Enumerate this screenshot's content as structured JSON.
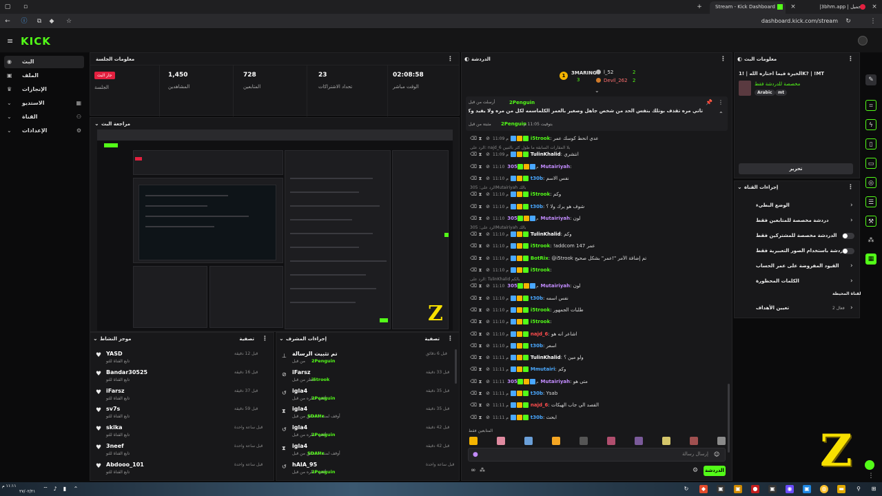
{
  "browser": {
    "tab_active": "Stream - Kick Dashboard",
    "tab_other": "|3bhm.app | تحميل",
    "url": "dashboard.kick.com/stream"
  },
  "kick": {
    "logo": "KICK"
  },
  "sidebar": {
    "items": [
      {
        "label": "البث",
        "icon": "broadcast-icon"
      },
      {
        "label": "الملف",
        "icon": "profile-icon"
      },
      {
        "label": "الإنجازات",
        "icon": "trophy-icon"
      },
      {
        "label": "الاستديو",
        "icon": "studio-icon"
      },
      {
        "label": "القناة",
        "icon": "channel-icon"
      },
      {
        "label": "الإعدادات",
        "icon": "settings-icon"
      }
    ]
  },
  "session": {
    "title": "معلومات الجلسة",
    "live_badge": "جار البث",
    "live_label": "الجلسة",
    "stats": [
      {
        "value": "1,450",
        "label": "المشاهدين"
      },
      {
        "value": "728",
        "label": "المتابعين"
      },
      {
        "value": "23",
        "label": "تحداد الاشتراكات"
      },
      {
        "value": "02:08:58",
        "label": "الوقت مباشر"
      }
    ]
  },
  "preview": {
    "title": "مراجعة البث"
  },
  "activity": {
    "title": "موجز النشاط",
    "filter": "تصفية",
    "items": [
      {
        "name": "YASD",
        "sub": "تابع القناة للتو",
        "time": "قبل 12 دقيقة"
      },
      {
        "name": "Bandar30525",
        "sub": "تابع القناة للتو",
        "time": "قبل 16 دقيقة"
      },
      {
        "name": "iFarsz",
        "sub": "تابع القناة للتو",
        "time": "قبل 37 دقيقة"
      },
      {
        "name": "sv7s",
        "sub": "تابع القناة للتو",
        "time": "قبل 59 دقيقة"
      },
      {
        "name": "skika",
        "sub": "تابع القناة للتو",
        "time": "قبل ساعة واحدة"
      },
      {
        "name": "3neef",
        "sub": "تابع القناة للتو",
        "time": "قبل ساعة واحدة"
      },
      {
        "name": "Abdooo_101",
        "sub": "تابع القناة للتو",
        "time": "قبل ساعة واحدة"
      }
    ]
  },
  "modactions": {
    "title": "إجراءات المشرف",
    "filter": "تصفية",
    "items": [
      {
        "name": "تم تثبيت الرسالة",
        "sub": "من قبل",
        "by": "2Penguin",
        "time": "قبل 6 دقائق",
        "icon": "pin-icon"
      },
      {
        "name": "iFarsz",
        "sub": "حظر من قبل",
        "by": "i5trook",
        "time": "قبل 33 دقيقة",
        "icon": "ban-icon"
      },
      {
        "name": "igla4",
        "sub": "ألغي حظره من قبل",
        "by": "2Penguin",
        "time": "قبل 35 دقيقة",
        "icon": "undo-icon"
      },
      {
        "name": "igla4",
        "sub": "أوقف لمدة 5 دقائق من قبل",
        "by": "SDAHx",
        "time": "قبل 35 دقيقة",
        "icon": "hourglass-icon"
      },
      {
        "name": "igla4",
        "sub": "ألغي حظره من قبل",
        "by": "2Penguin",
        "time": "قبل 42 دقيقة",
        "icon": "undo-icon"
      },
      {
        "name": "igla4",
        "sub": "أوقف لمدة 5 دقائق من قبل",
        "by": "SDAHx",
        "time": "قبل 42 دقيقة",
        "icon": "hourglass-icon"
      },
      {
        "name": "hAIA_95",
        "sub": "ألغي حظره من قبل",
        "by": "2Penguin",
        "time": "قبل ساعة واحدة",
        "icon": "undo-icon"
      }
    ]
  },
  "chat": {
    "title": "الدردشة",
    "top": [
      {
        "name": "3MARING",
        "count": "3"
      },
      {
        "name": "l_52",
        "count": "2"
      },
      {
        "name": "Devil_262",
        "count": "2"
      }
    ],
    "pinned": {
      "header": "أرسلت من قبل",
      "by": "2Penguin",
      "text": "تاتي مره تقذف بوتلك بنفس الحد من شخص جاهل وصغير بالعمر الكلماسمه لكل من مره ولا يفيد وكثرو الادعاء عليه",
      "footer_time": "بتوقيت 11:05 م",
      "footer_by": "2Penguin",
      "footer_label": "مثبتة من قبل"
    },
    "messages": [
      {
        "time": "11:09 م",
        "user": "i5trook",
        "color": "#53fc18",
        "text": "عدي انحط كوسك عمر",
        "reply": ""
      },
      {
        "time": "11:09 م",
        "user": "TulinKhalid",
        "color": "#ffffff",
        "text": "انتشري",
        "reply": "الرد على: najd_6 بلا المقارات السابقة ما طول كثر بالتبين"
      },
      {
        "time": "11:10 م",
        "user": "305Mutairiyah",
        "color": "#c38cff",
        "text": "",
        "reply": ""
      },
      {
        "time": "11:10 م",
        "user": "t30b",
        "color": "#4aa8ff",
        "text": "نفس الاسم",
        "reply": ""
      },
      {
        "time": "11:10 م",
        "user": "i5trook",
        "color": "#53fc18",
        "text": "وكم",
        "reply": "الرد على: 305Mutairiyah بالك"
      },
      {
        "time": "11:10 م",
        "user": "t30b",
        "color": "#4aa8ff",
        "text": "شوف هو يرك ولا ؟",
        "reply": ""
      },
      {
        "time": "11:10 م",
        "user": "305Mutairiyah",
        "color": "#c38cff",
        "text": "لون",
        "reply": ""
      },
      {
        "time": "11:10 م",
        "user": "TulinKhalid",
        "color": "#ffffff",
        "text": "وكم",
        "reply": "الرد على: 305Mutairiyah بالك"
      },
      {
        "time": "11:10 م",
        "user": "i5trook",
        "color": "#53fc18",
        "text": "!addcom 147 عمر",
        "reply": ""
      },
      {
        "time": "11:10 م",
        "user": "BotRix",
        "color": "#53fc18",
        "text": "@i5trook تم إضافة الأمر \"!عمر\" بشكل صحيح",
        "reply": ""
      },
      {
        "time": "11:10 م",
        "user": "i5trook",
        "color": "#53fc18",
        "text": "",
        "reply": ""
      },
      {
        "time": "11:10 م",
        "user": "305Mutairiyah",
        "color": "#c38cff",
        "text": "لون",
        "reply": "الرد على: TulinKhalid بالكم"
      },
      {
        "time": "11:10 م",
        "user": "t30b",
        "color": "#4aa8ff",
        "text": "نفس اسمه",
        "reply": ""
      },
      {
        "time": "11:10 م",
        "user": "i5trook",
        "color": "#53fc18",
        "text": "طلبات الجمهور",
        "reply": ""
      },
      {
        "time": "11:10 م",
        "user": "i5trook",
        "color": "#53fc18",
        "text": "",
        "reply": ""
      },
      {
        "time": "11:10 م",
        "user": "najd_6",
        "color": "#ff4d4d",
        "text": "اشاعر انه هو",
        "reply": ""
      },
      {
        "time": "11:10 م",
        "user": "t30b",
        "color": "#4aa8ff",
        "text": "اسعر",
        "reply": ""
      },
      {
        "time": "11:11 م",
        "user": "TulinKhalid",
        "color": "#ffffff",
        "text": "ولو مين ؟",
        "reply": ""
      },
      {
        "time": "11:11 م",
        "user": "Mmutairi",
        "color": "#4aa8ff",
        "text": "وكم",
        "reply": ""
      },
      {
        "time": "11:11 م",
        "user": "305Mutairiyah",
        "color": "#c38cff",
        "text": "متى هو",
        "reply": ""
      },
      {
        "time": "11:11 م",
        "user": "t30b",
        "color": "#4aa8ff",
        "text": "Ysab",
        "reply": ""
      },
      {
        "time": "11:11 م",
        "user": "najd_6",
        "color": "#ff4d4d",
        "text": "القصد الي جاب الهيكات",
        "reply": ""
      },
      {
        "time": "11:11 م",
        "user": "t30b",
        "color": "#4aa8ff",
        "text": "ابحث",
        "reply": ""
      }
    ],
    "followers_only": "المتابعين فقط",
    "input_placeholder": "إرسال رسالة",
    "send_label": "الدردشة"
  },
  "stream_info": {
    "title": "معلومات البث",
    "stream_title": "الخيرة فيما اختاره الله | !1K? | !MT",
    "category": "مخصصة للدردشة فقط",
    "tags": [
      "Arabic",
      "mt"
    ],
    "edit_label": "تحرير"
  },
  "channel_actions": {
    "title": "إجراءات القناة",
    "items": [
      {
        "label": "الوضع البطيء",
        "control": "chevron"
      },
      {
        "label": "دردشة مخصصة للمتابعين فقط",
        "control": "chevron"
      },
      {
        "label": "الدردشة مخصصة للمشتركين فقط",
        "control": "toggle"
      },
      {
        "label": "الدردشة باستخدام الصور التعبيرية فقط",
        "control": "toggle"
      },
      {
        "label": "القيود المفروضة على عمر الحساب",
        "control": "chevron"
      },
      {
        "label": "الكلمات المحظورة",
        "control": "chevron"
      }
    ],
    "channel_raid": "القناة المحيطة",
    "raid_target": "تعيين الأهداف",
    "raid_value": "فعال 2"
  },
  "taskbar": {
    "time": "١١:١١ م",
    "date": "٢٧/٠٢/٢١"
  }
}
